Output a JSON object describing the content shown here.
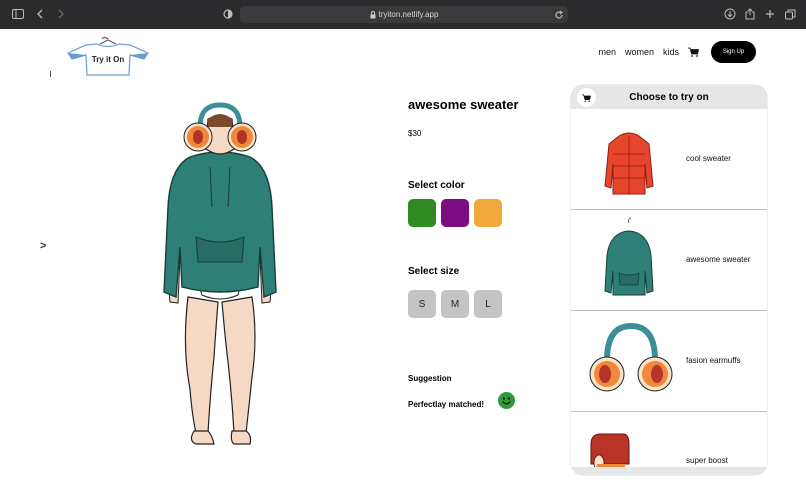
{
  "browser": {
    "url": "tryiton.netlify.app"
  },
  "brand": {
    "logo_text": "Try it On"
  },
  "nav": {
    "links": [
      "men",
      "women",
      "kids"
    ],
    "signup_label": "Sign Up"
  },
  "carousel": {
    "next_arrow": ">"
  },
  "product": {
    "title": "awesome sweater",
    "price": "$30",
    "color_heading": "Select color",
    "colors": [
      "#2f8a22",
      "#7a0d82",
      "#f2a93b"
    ],
    "size_heading": "Select size",
    "sizes": [
      "S",
      "M",
      "L"
    ],
    "suggestion_heading": "Suggestion",
    "suggestion_text": "Perfectlay matched!"
  },
  "tryon_panel": {
    "title": "Choose to try on",
    "items": [
      {
        "label": "cool sweater",
        "icon": "red-puffer-jacket"
      },
      {
        "label": "awesome sweater",
        "icon": "green-hoodie"
      },
      {
        "label": "fasion earmuffs",
        "icon": "orange-earmuffs"
      },
      {
        "label": "super boost",
        "icon": "boot"
      }
    ]
  },
  "colors": {
    "chrome_bg": "#2b2b2d",
    "signup_bg": "#000000",
    "panel_header_bg": "#e6e6e6",
    "size_button_bg": "#c4c4c4",
    "hoodie_green": "#2e8076",
    "earmuff_orange": "#f0883a",
    "smile_green": "#2f9a3a"
  }
}
